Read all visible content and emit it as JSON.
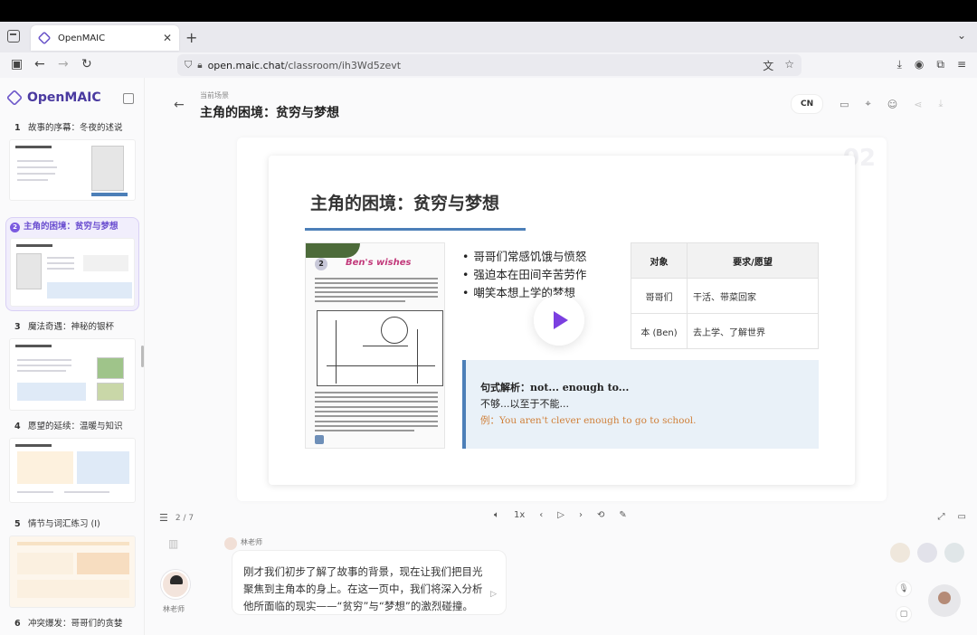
{
  "browser": {
    "tab_title": "OpenMAIC",
    "url_host": "open.maic.chat",
    "url_path": "/classroom/ih3Wd5zevt"
  },
  "app": {
    "brand": "OpenMAIC",
    "scene_label": "当前场景",
    "scene_title": "主角的困境：贫穷与梦想",
    "lang": "CN"
  },
  "sidebar": {
    "scenes": [
      {
        "num": "1",
        "title": "故事的序幕：冬夜的述说"
      },
      {
        "num": "2",
        "title": "主角的困境：贫穷与梦想"
      },
      {
        "num": "3",
        "title": "魔法奇遇：神秘的银杯"
      },
      {
        "num": "4",
        "title": "愿望的延续：温暖与知识"
      },
      {
        "num": "5",
        "title": "情节与词汇练习 (I)"
      },
      {
        "num": "6",
        "title": "冲突爆发：哥哥们的贪婪"
      }
    ]
  },
  "slide": {
    "number": "02",
    "title": "主角的困境：贫穷与梦想",
    "book_num": "2",
    "book_heading": "Ben's wishes",
    "bullets": [
      "哥哥们常感饥饿与愤怒",
      "强迫本在田间辛苦劳作",
      "嘲笑本想上学的梦想"
    ],
    "table": {
      "headers": [
        "对象",
        "要求/愿望"
      ],
      "rows": [
        [
          "哥哥们",
          "干活、带菜回家"
        ],
        [
          "本 (Ben)",
          "去上学、了解世界"
        ]
      ]
    },
    "grammar": {
      "title": "句式解析：not... enough to...",
      "meaning": "不够...以至于不能...",
      "example": "例：You aren't clever enough to go to school."
    }
  },
  "controls": {
    "page": "2 / 7",
    "speed": "1x"
  },
  "chat": {
    "teacher_name": "林老师",
    "speaker": "林老师",
    "message": "刚才我们初步了解了故事的背景，现在让我们把目光聚焦到主角本的身上。在这一页中，我们将深入分析他所面临的现实——“贫穷”与“梦想”的激烈碰撞。"
  }
}
